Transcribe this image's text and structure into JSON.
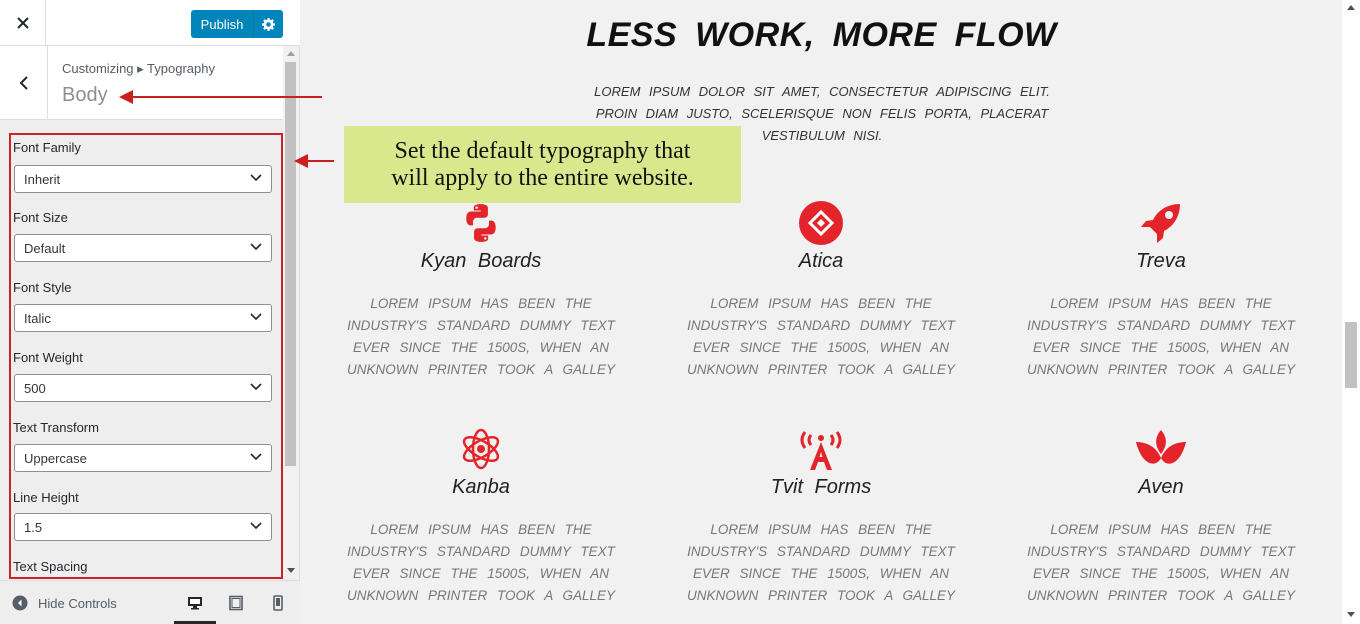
{
  "topbar": {
    "publish_label": "Publish"
  },
  "section": {
    "breadcrumb": "Customizing ▸ Typography",
    "title": "Body"
  },
  "controls": [
    {
      "label": "Font Family",
      "value": "Inherit"
    },
    {
      "label": "Font Size",
      "value": "Default"
    },
    {
      "label": "Font Style",
      "value": "Italic"
    },
    {
      "label": "Font Weight",
      "value": "500"
    },
    {
      "label": "Text Transform",
      "value": "Uppercase"
    },
    {
      "label": "Line Height",
      "value": "1.5"
    },
    {
      "label": "Text Spacing"
    }
  ],
  "footer": {
    "hide_controls": "Hide Controls"
  },
  "preview": {
    "hero_title": "LESS WORK, MORE FLOW",
    "hero_text": "Lorem ipsum dolor sit amet, consectetur adipiscing elit. Proin diam justo, scelerisque non felis porta, placerat vestibulum nisi.",
    "cards": [
      {
        "title": "Kyan Boards",
        "text": "Lorem Ipsum has been the industry's standard dummy text ever since the 1500s, when an unknown printer took a galley",
        "icon": "python-icon"
      },
      {
        "title": "Atica",
        "text": "Lorem Ipsum has been the industry's standard dummy text ever since the 1500s, when an unknown printer took a galley",
        "icon": "diamond-logo-icon"
      },
      {
        "title": "Treva",
        "text": "Lorem Ipsum has been the industry's standard dummy text ever since the 1500s, when an unknown printer took a galley",
        "icon": "rocket-icon"
      },
      {
        "title": "Kanba",
        "text": "Lorem Ipsum has been the industry's standard dummy text ever since the 1500s, when an unknown printer took a galley",
        "icon": "atom-icon"
      },
      {
        "title": "Tvit Forms",
        "text": "Lorem Ipsum has been the industry's standard dummy text ever since the 1500s, when an unknown printer took a galley",
        "icon": "broadcast-icon"
      },
      {
        "title": "Aven",
        "text": "Lorem Ipsum has been the industry's standard dummy text ever since the 1500s, when an unknown printer took a galley",
        "icon": "lotus-icon"
      }
    ]
  },
  "callout": {
    "line1": "Set the default typography that",
    "line2": "will apply to the entire website."
  },
  "colors": {
    "accent": "#0085ba",
    "annotation_red": "#c9201f",
    "callout_bg": "#d9e88c",
    "icon_red": "#e3252b"
  }
}
